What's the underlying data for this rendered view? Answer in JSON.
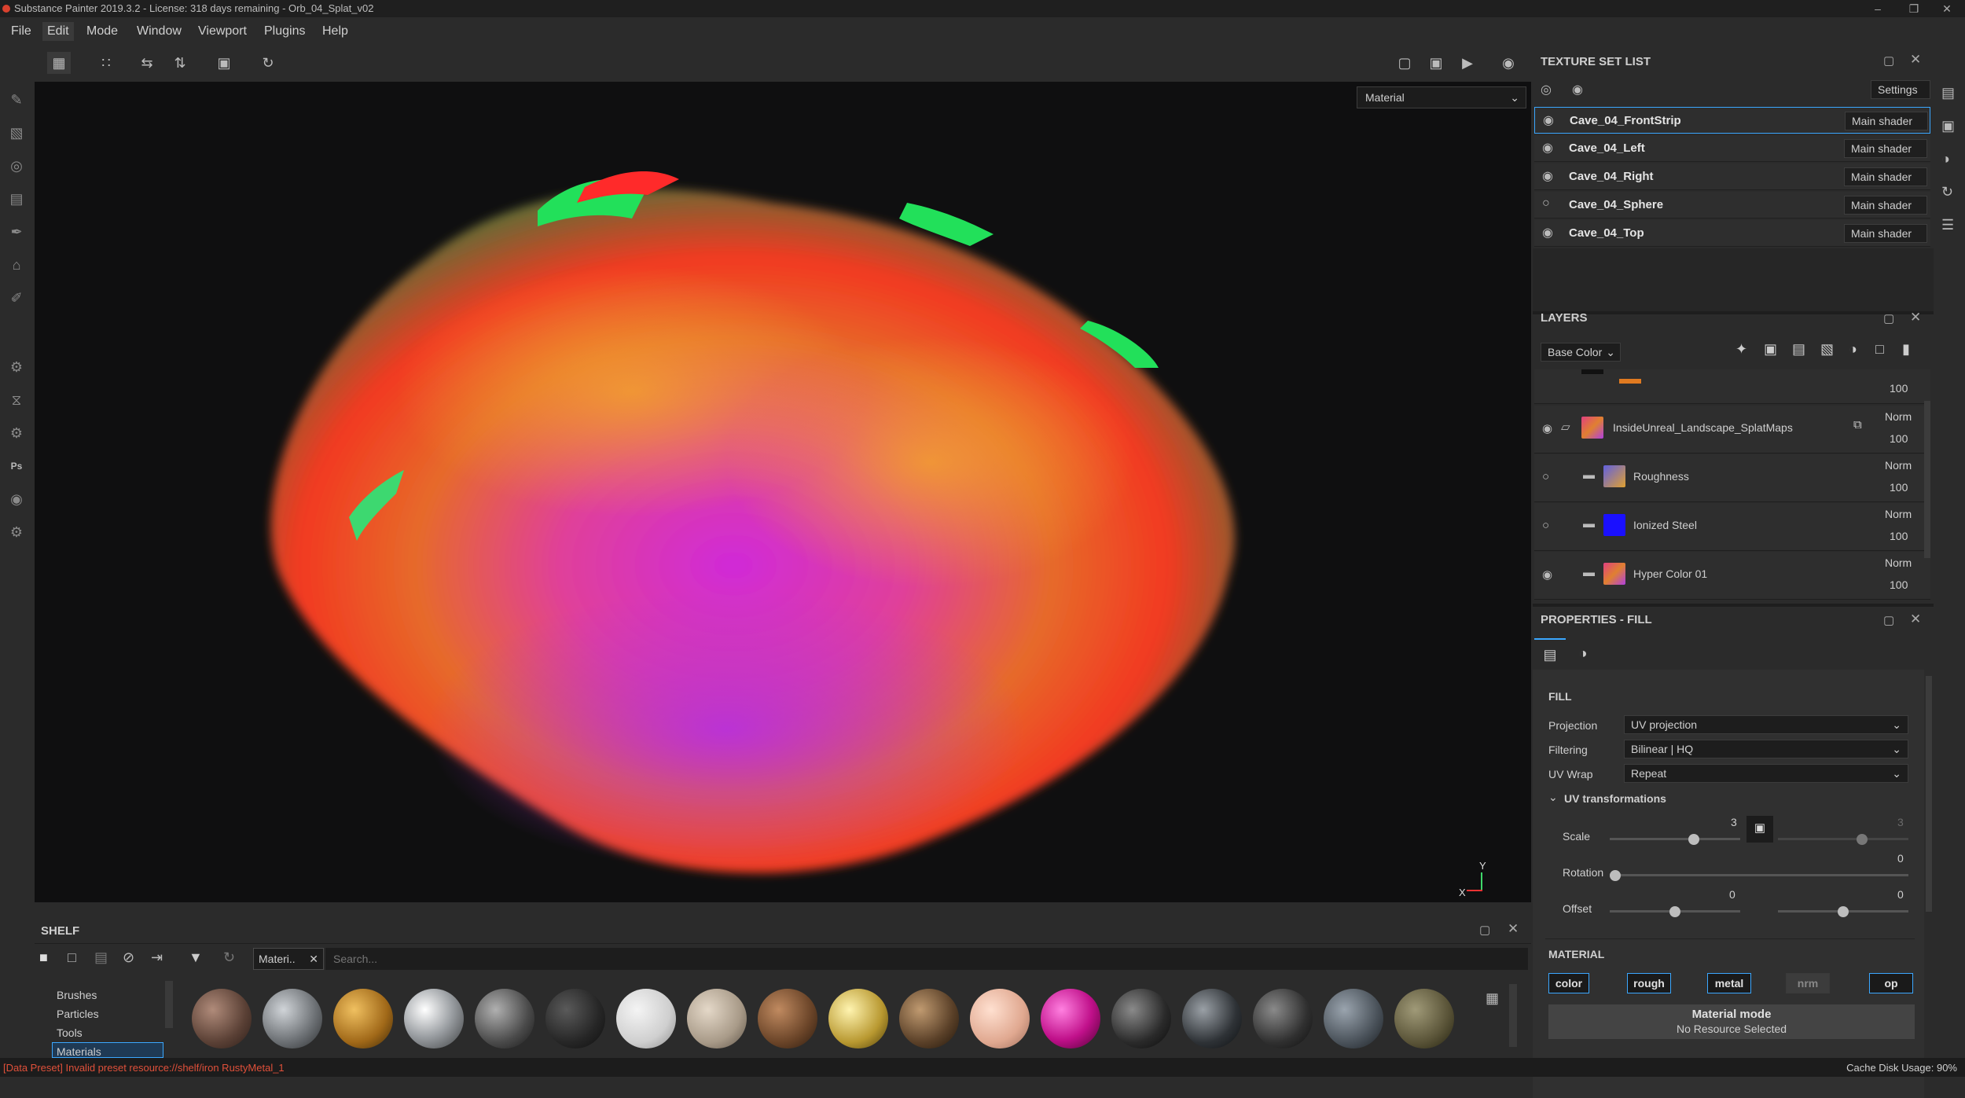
{
  "app": {
    "title": "Substance Painter 2019.3.2 - License: 318 days remaining - Orb_04_Splat_v02"
  },
  "menu": [
    "File",
    "Edit",
    "Mode",
    "Window",
    "Viewport",
    "Plugins",
    "Help"
  ],
  "viewport": {
    "channel_select": "Material",
    "axis_x": "X",
    "axis_y": "Y"
  },
  "texture_set_list": {
    "title": "TEXTURE SET LIST",
    "settings_label": "Settings",
    "items": [
      {
        "name": "Cave_04_FrontStrip",
        "shader": "Main shader"
      },
      {
        "name": "Cave_04_Left",
        "shader": "Main shader"
      },
      {
        "name": "Cave_04_Right",
        "shader": "Main shader"
      },
      {
        "name": "Cave_04_Sphere",
        "shader": "Main shader"
      },
      {
        "name": "Cave_04_Top",
        "shader": "Main shader"
      }
    ]
  },
  "layers": {
    "title": "LAYERS",
    "channel": "Base Color",
    "top_opacity": "100",
    "items": [
      {
        "name": "InsideUnreal_Landscape_SplatMaps",
        "blend": "Norm",
        "opacity": "100"
      },
      {
        "name": "Roughness",
        "blend": "Norm",
        "opacity": "100"
      },
      {
        "name": "Ionized Steel",
        "blend": "Norm",
        "opacity": "100"
      },
      {
        "name": "Hyper Color 01",
        "blend": "Norm",
        "opacity": "100"
      }
    ]
  },
  "properties": {
    "title": "PROPERTIES - FILL",
    "fill_header": "FILL",
    "projection_label": "Projection",
    "projection_value": "UV projection",
    "filtering_label": "Filtering",
    "filtering_value": "Bilinear | HQ",
    "uvwrap_label": "UV Wrap",
    "uvwrap_value": "Repeat",
    "uv_transform_header": "UV transformations",
    "scale_label": "Scale",
    "scale_value": "3",
    "scale_value_b": "3",
    "rotation_label": "Rotation",
    "rotation_value": "0",
    "offset_label": "Offset",
    "offset_value_a": "0",
    "offset_value_b": "0",
    "material_header": "MATERIAL",
    "channels": [
      "color",
      "rough",
      "metal",
      "nrm",
      "op"
    ],
    "material_mode": "Material mode",
    "no_resource": "No Resource Selected"
  },
  "shelf": {
    "title": "SHELF",
    "filter_tag": "Materi..",
    "search_placeholder": "Search...",
    "categories": [
      "Brushes",
      "Particles",
      "Tools",
      "Materials"
    ]
  },
  "status": {
    "error": "[Data Preset] Invalid preset resource://shelf/iron RustyMetal_1",
    "cache": "Cache Disk Usage: 90%"
  }
}
